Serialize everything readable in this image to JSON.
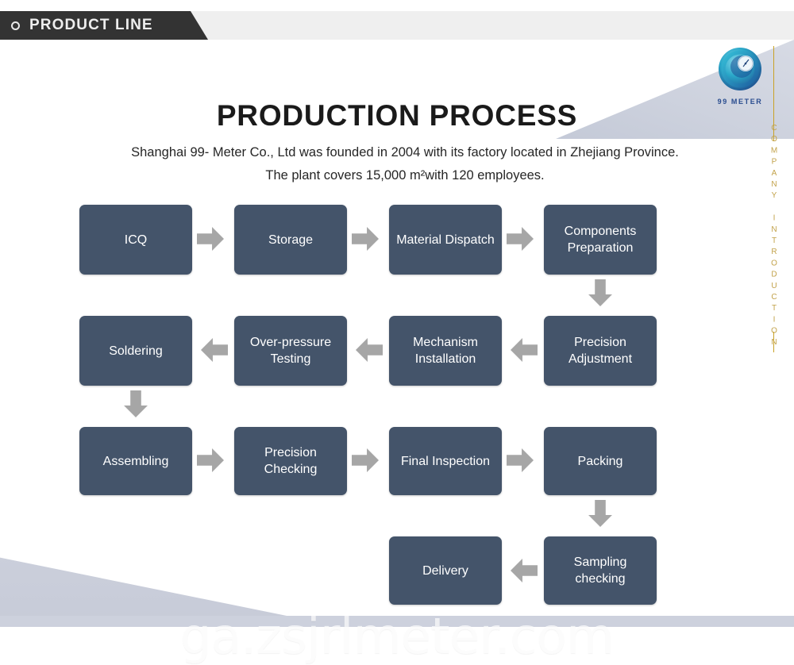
{
  "header": {
    "tab_label": "PRODUCT LINE",
    "bullet_icon": "circle-outline-icon"
  },
  "logo": {
    "brand": "99 METER",
    "icon": "meter-swirl-logo"
  },
  "side": {
    "vertical_text": "COMPANY INTRODUCTION"
  },
  "title": "PRODUCTION PROCESS",
  "intro": "Shanghai 99- Meter Co., Ltd was founded in 2004 with its factory located in Zhejiang Province. The plant covers 15,000 m²with 120 employees.",
  "watermark": "ga.zsjrlmeter.com",
  "colors": {
    "node_fill": "#44546a",
    "arrow_fill": "#a6a6a6",
    "header_tab": "#333333",
    "header_band": "#efefef",
    "gold": "#c9a227",
    "deco": "#ccd0dc"
  },
  "flow": {
    "rows": [
      {
        "direction": "right",
        "nodes": [
          "ICQ",
          "Storage",
          "Material Dispatch",
          "Components Preparation"
        ]
      },
      {
        "direction": "left",
        "nodes": [
          "Soldering",
          "Over-pressure Testing",
          "Mechanism Installation",
          "Precision Adjustment"
        ]
      },
      {
        "direction": "right",
        "nodes": [
          "Assembling",
          "Precision Checking",
          "Final Inspection",
          "Packing"
        ]
      },
      {
        "direction": "left",
        "nodes": [
          "Delivery",
          "Sampling checking"
        ]
      }
    ],
    "nodes": {
      "r1c1": "ICQ",
      "r1c2": "Storage",
      "r1c3": "Material Dispatch",
      "r1c4": "Components Preparation",
      "r2c1": "Soldering",
      "r2c2": "Over-pressure Testing",
      "r2c3": "Mechanism Installation",
      "r2c4": "Precision Adjustment",
      "r3c1": "Assembling",
      "r3c2": "Precision Checking",
      "r3c3": "Final Inspection",
      "r3c4": "Packing",
      "r4c3": "Delivery",
      "r4c4": "Sampling checking"
    }
  }
}
